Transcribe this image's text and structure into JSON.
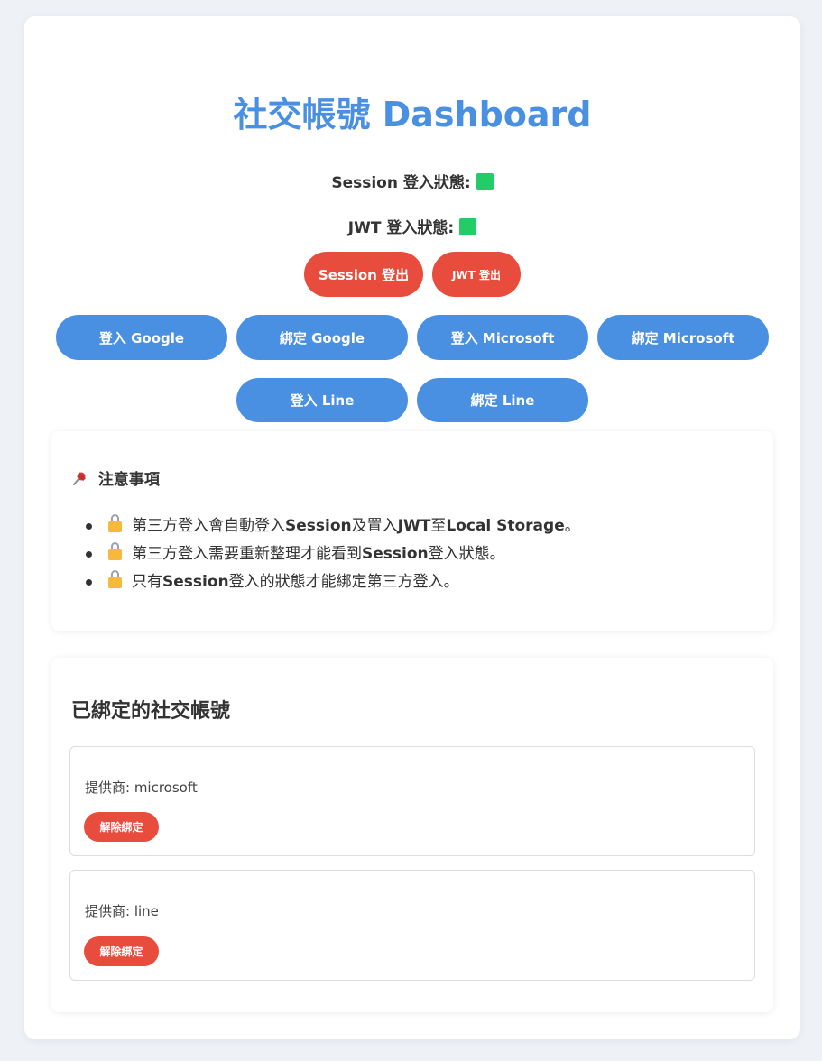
{
  "header": {
    "title": "社交帳號 Dashboard",
    "session_status_label": "Session 登入狀態:",
    "jwt_status_label": "JWT 登入狀態:",
    "status_color": "#22cc66"
  },
  "logout_buttons": {
    "session_logout": "Session 登出",
    "jwt_logout": "JWT 登出"
  },
  "auth_buttons": [
    {
      "label": "登入 Google"
    },
    {
      "label": "綁定 Google"
    },
    {
      "label": "登入 Microsoft"
    },
    {
      "label": "綁定 Microsoft"
    },
    {
      "label": "登入 Line"
    },
    {
      "label": "綁定 Line"
    }
  ],
  "notice": {
    "icon": "pushpin-icon",
    "title": "注意事項",
    "items": [
      {
        "pre": "第三方登入會自動登入",
        "b1": "Session",
        "mid1": "及置入",
        "b2": "JWT",
        "mid2": "至",
        "b3": "Local Storage",
        "post": "。"
      },
      {
        "pre": "第三方登入需要重新整理才能看到",
        "b1": "Session",
        "post": "登入狀態。"
      },
      {
        "pre": "只有",
        "b1": "Session",
        "post": "登入的狀態才能綁定第三方登入。"
      }
    ]
  },
  "bound_accounts": {
    "title": "已綁定的社交帳號",
    "items": [
      {
        "provider": "提供商: microsoft",
        "unbind_label": "解除綁定"
      },
      {
        "provider": "提供商: line",
        "unbind_label": "解除綁定"
      }
    ]
  },
  "colors": {
    "primary": "#4a90e2",
    "danger": "#e74c3c",
    "background": "#eef2f7"
  }
}
